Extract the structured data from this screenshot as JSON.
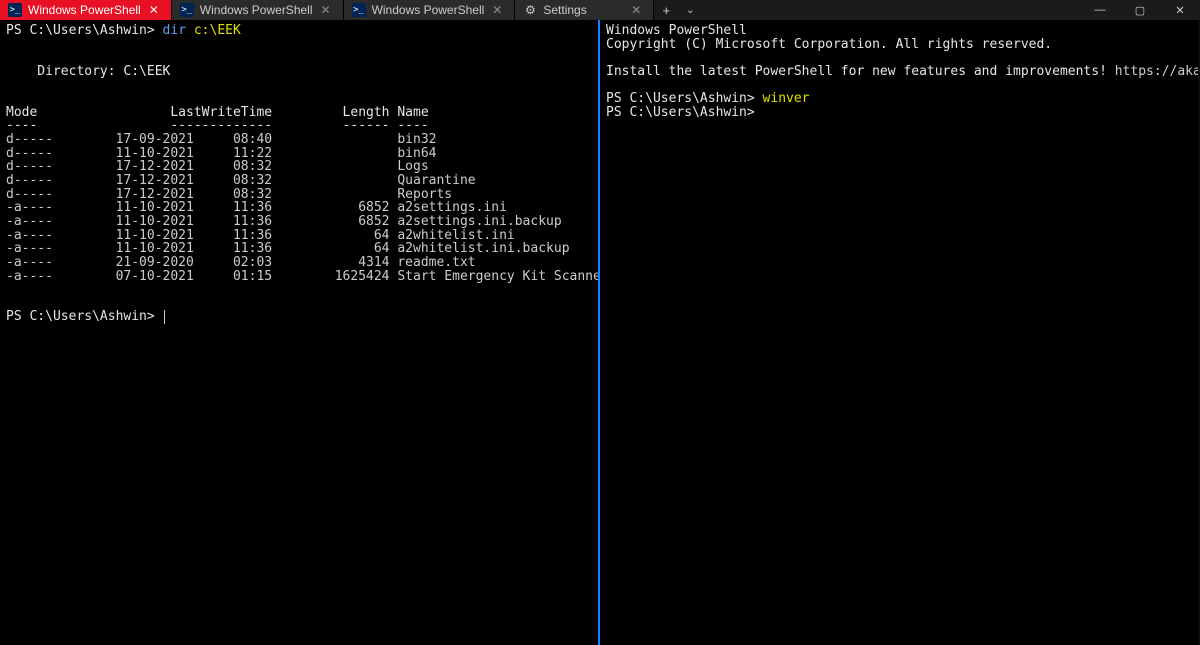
{
  "tabs": [
    {
      "label": "Windows PowerShell",
      "active": true,
      "icon": "ps"
    },
    {
      "label": "Windows PowerShell",
      "active": false,
      "icon": "ps"
    },
    {
      "label": "Windows PowerShell",
      "active": false,
      "icon": "ps"
    },
    {
      "label": "Settings",
      "active": false,
      "icon": "gear"
    }
  ],
  "window": {
    "new_tab": "+",
    "dropdown": "⌄",
    "min": "—",
    "max": "▢",
    "close": "✕"
  },
  "left": {
    "prompt1": "PS C:\\Users\\Ashwin>",
    "cmd1_kw": "dir",
    "cmd1_arg": " c:\\EEK",
    "dir_header": "    Directory: C:\\EEK",
    "col_headers": "Mode                 LastWriteTime         Length Name",
    "col_rule": "----                 -------------         ------ ----",
    "prompt2": "PS C:\\Users\\Ashwin>",
    "rows": [
      {
        "mode": "d-----",
        "date": "17-09-2021",
        "time": "08:40",
        "length": "",
        "name": "bin32"
      },
      {
        "mode": "d-----",
        "date": "11-10-2021",
        "time": "11:22",
        "length": "",
        "name": "bin64"
      },
      {
        "mode": "d-----",
        "date": "17-12-2021",
        "time": "08:32",
        "length": "",
        "name": "Logs"
      },
      {
        "mode": "d-----",
        "date": "17-12-2021",
        "time": "08:32",
        "length": "",
        "name": "Quarantine"
      },
      {
        "mode": "d-----",
        "date": "17-12-2021",
        "time": "08:32",
        "length": "",
        "name": "Reports"
      },
      {
        "mode": "-a----",
        "date": "11-10-2021",
        "time": "11:36",
        "length": "6852",
        "name": "a2settings.ini"
      },
      {
        "mode": "-a----",
        "date": "11-10-2021",
        "time": "11:36",
        "length": "6852",
        "name": "a2settings.ini.backup"
      },
      {
        "mode": "-a----",
        "date": "11-10-2021",
        "time": "11:36",
        "length": "64",
        "name": "a2whitelist.ini"
      },
      {
        "mode": "-a----",
        "date": "11-10-2021",
        "time": "11:36",
        "length": "64",
        "name": "a2whitelist.ini.backup"
      },
      {
        "mode": "-a----",
        "date": "21-09-2020",
        "time": "02:03",
        "length": "4314",
        "name": "readme.txt"
      },
      {
        "mode": "-a----",
        "date": "07-10-2021",
        "time": "01:15",
        "length": "1625424",
        "name": "Start Emergency Kit Scanner.exe"
      }
    ]
  },
  "right": {
    "banner1": "Windows PowerShell",
    "banner2": "Copyright (C) Microsoft Corporation. All rights reserved.",
    "install_msg": "Install the latest PowerShell for new features and improvements! ",
    "install_link": "https://aka.ms/PSWindows",
    "prompt1": "PS C:\\Users\\Ashwin>",
    "cmd1": "winver",
    "prompt2": "PS C:\\Users\\Ashwin>"
  }
}
